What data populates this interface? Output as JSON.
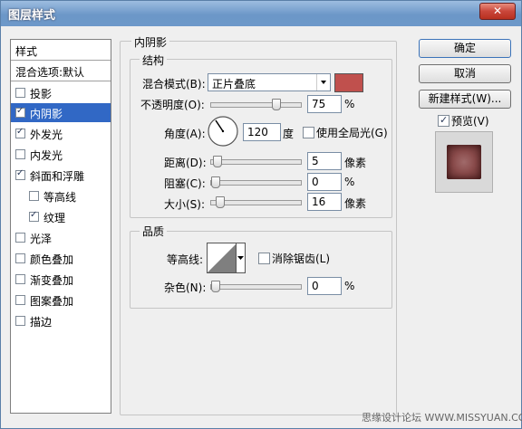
{
  "window": {
    "title": "图层样式",
    "close_label": "✕"
  },
  "left_panel": {
    "header": "样式",
    "blend_options": "混合选项:默认",
    "items": [
      {
        "label": "投影",
        "checked": false,
        "selected": false,
        "indent": false
      },
      {
        "label": "内阴影",
        "checked": true,
        "selected": true,
        "indent": false
      },
      {
        "label": "外发光",
        "checked": true,
        "selected": false,
        "indent": false
      },
      {
        "label": "内发光",
        "checked": false,
        "selected": false,
        "indent": false
      },
      {
        "label": "斜面和浮雕",
        "checked": true,
        "selected": false,
        "indent": false
      },
      {
        "label": "等高线",
        "checked": false,
        "selected": false,
        "indent": true
      },
      {
        "label": "纹理",
        "checked": true,
        "selected": false,
        "indent": true
      },
      {
        "label": "光泽",
        "checked": false,
        "selected": false,
        "indent": false
      },
      {
        "label": "颜色叠加",
        "checked": false,
        "selected": false,
        "indent": false
      },
      {
        "label": "渐变叠加",
        "checked": false,
        "selected": false,
        "indent": false
      },
      {
        "label": "图案叠加",
        "checked": false,
        "selected": false,
        "indent": false
      },
      {
        "label": "描边",
        "checked": false,
        "selected": false,
        "indent": false
      }
    ]
  },
  "inner_shadow": {
    "title": "内阴影",
    "structure": {
      "title": "结构",
      "blend_mode_label": "混合模式(B):",
      "blend_mode_value": "正片叠底",
      "blend_color": "#c0504d",
      "opacity_label": "不透明度(O):",
      "opacity_value": "75",
      "opacity_unit": "%",
      "opacity_level": 0.75,
      "angle_label": "角度(A):",
      "angle_value": "120",
      "angle_unit": "度",
      "global_light_label": "使用全局光(G)",
      "global_light_checked": false,
      "distance_label": "距离(D):",
      "distance_value": "5",
      "distance_unit": "像素",
      "distance_level": 0.02,
      "choke_label": "阻塞(C):",
      "choke_value": "0",
      "choke_unit": "%",
      "choke_level": 0.0,
      "size_label": "大小(S):",
      "size_value": "16",
      "size_unit": "像素",
      "size_level": 0.06
    },
    "quality": {
      "title": "品质",
      "contour_label": "等高线:",
      "antialias_label": "消除锯齿(L)",
      "antialias_checked": false,
      "noise_label": "杂色(N):",
      "noise_value": "0",
      "noise_unit": "%",
      "noise_level": 0.0
    }
  },
  "buttons": {
    "ok": "确定",
    "cancel": "取消",
    "new_style": "新建样式(W)...",
    "preview_label": "预览(V)",
    "preview_checked": true
  },
  "watermark": "思缘设计论坛 WWW.MISSYUAN.COM"
}
